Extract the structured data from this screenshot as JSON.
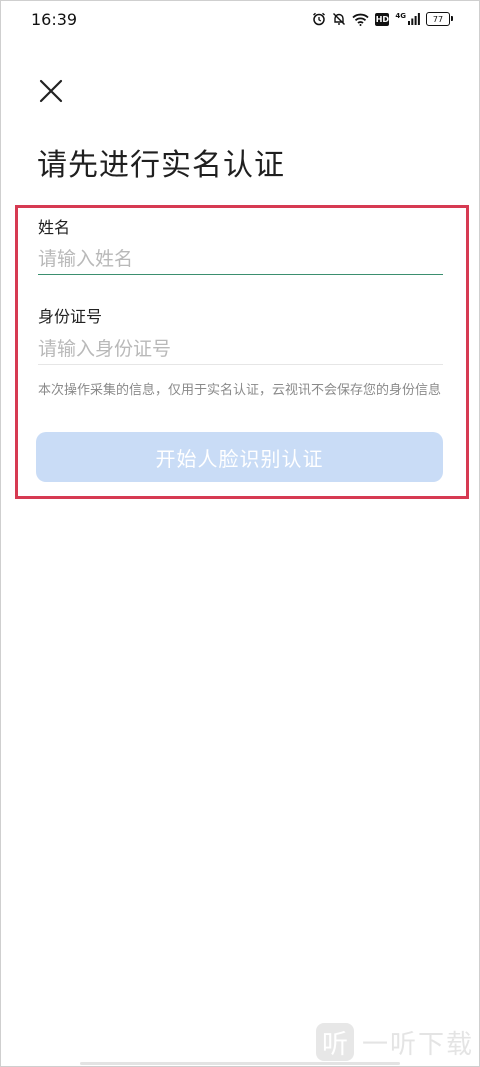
{
  "status_bar": {
    "time": "16:39",
    "hd": "HD",
    "network": "4G",
    "battery": "77"
  },
  "header": {
    "title": "请先进行实名认证"
  },
  "form": {
    "name_label": "姓名",
    "name_placeholder": "请输入姓名",
    "name_value": "",
    "id_label": "身份证号",
    "id_placeholder": "请输入身份证号",
    "id_value": "",
    "notice": "本次操作采集的信息，仅用于实名认证，云视讯不会保存您的身份信息",
    "submit_label": "开始人脸识别认证",
    "highlight_color": "#d63a52",
    "button_color": "#c9dcf6"
  },
  "watermark": {
    "logo_glyph": "听",
    "text": "一听下载"
  }
}
